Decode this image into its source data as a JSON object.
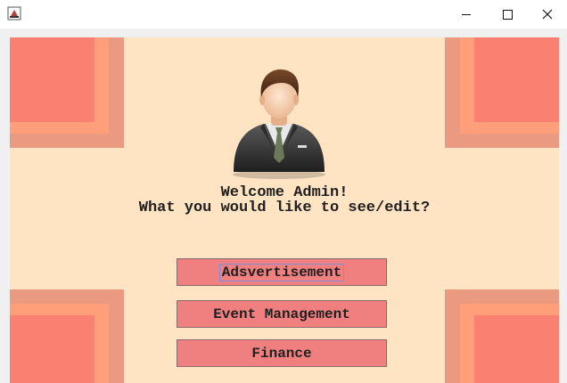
{
  "window": {
    "app_icon": "java-cup-icon",
    "controls": [
      "minimize-icon",
      "maximize-icon",
      "close-icon"
    ]
  },
  "welcome": {
    "line1": "Welcome Admin!",
    "line2": "What you would like to see/edit?"
  },
  "avatar": {
    "icon": "businessman-avatar-icon"
  },
  "menu": {
    "buttons": [
      {
        "label": "Adsvertisement"
      },
      {
        "label": "Event Management"
      },
      {
        "label": "Finance"
      }
    ]
  },
  "colors": {
    "background": "#ffe4c4",
    "button": "#f08080",
    "corner_outer": "#ea9a80",
    "corner_middle": "#ff9f7a",
    "corner_inner": "#fa8072"
  }
}
